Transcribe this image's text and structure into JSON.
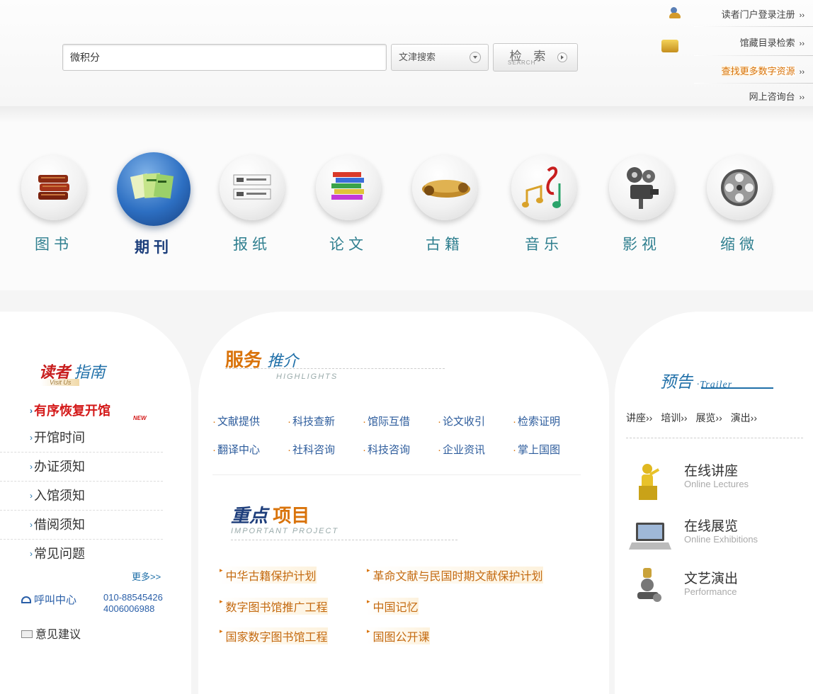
{
  "search": {
    "query": "微积分",
    "scope": "文津搜索",
    "button": "检 索",
    "button_en": "SEARCH"
  },
  "toplinks": [
    {
      "label": "读者门户登录注册"
    },
    {
      "label": "馆藏目录检索"
    },
    {
      "label": "查找更多数字资源"
    },
    {
      "label": "网上咨询台"
    }
  ],
  "chevron": "››",
  "nav": [
    {
      "label": "图书",
      "icon": "books-icon"
    },
    {
      "label": "期刊",
      "icon": "journals-icon"
    },
    {
      "label": "报纸",
      "icon": "newspaper-icon"
    },
    {
      "label": "论文",
      "icon": "papers-icon"
    },
    {
      "label": "古籍",
      "icon": "scrolls-icon"
    },
    {
      "label": "音乐",
      "icon": "music-icon"
    },
    {
      "label": "影视",
      "icon": "projector-icon"
    },
    {
      "label": "缩微",
      "icon": "film-reel-icon"
    }
  ],
  "guide": {
    "title_red": "读者",
    "title_blue": "指南",
    "subtitle": "Visit Us",
    "items": [
      "有序恢复开馆",
      "开馆时间",
      "办证须知",
      "入馆须知",
      "借阅须知",
      "常见问题"
    ],
    "new_badge": "NEW",
    "more": "更多>>",
    "hotline_label": "呼叫中心",
    "hotline_1": "010-88545426",
    "hotline_2": "4006006988",
    "feedback": "意见建议"
  },
  "services": {
    "title": "服务",
    "title_it": "推介",
    "en": "HIGHLIGHTS",
    "items": [
      "文献提供",
      "科技查新",
      "馆际互借",
      "论文收引",
      "检索证明",
      "翻译中心",
      "社科咨询",
      "科技咨询",
      "企业资讯",
      "掌上国图"
    ]
  },
  "projects": {
    "title_it": "重点",
    "title": "项目",
    "en": "IMPORTANT PROJECT",
    "items": [
      "中华古籍保护计划",
      "革命文献与民国时期文献保护计划",
      "数字图书馆推广工程",
      "中国记忆",
      "国家数字图书馆工程",
      "国图公开课"
    ]
  },
  "trailer": {
    "title": "预告",
    "en": "·Trailer",
    "links": [
      "讲座››",
      "培训››",
      "展览››",
      "演出››"
    ],
    "features": [
      {
        "title": "在线讲座",
        "en": "Online Lectures"
      },
      {
        "title": "在线展览",
        "en": "Online Exhibitions"
      },
      {
        "title": "文艺演出",
        "en": "Performance"
      }
    ]
  }
}
